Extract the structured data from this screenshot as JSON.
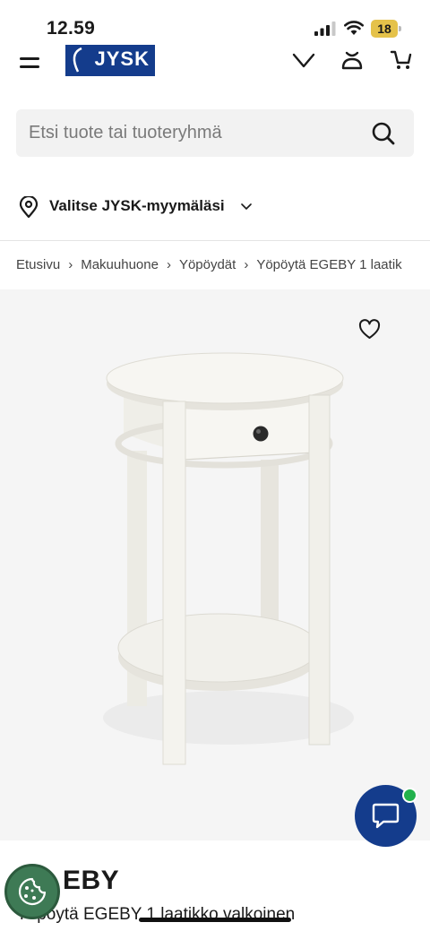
{
  "status_bar": {
    "time": "12.59",
    "battery": "18",
    "icons": [
      "cellular-signal-icon",
      "wifi-icon",
      "battery-icon"
    ]
  },
  "header": {
    "logo_text": "JYSK",
    "icons": [
      "menu-icon",
      "heart-icon",
      "account-icon",
      "cart-icon"
    ]
  },
  "search": {
    "placeholder": "Etsi tuote tai tuoteryhmä",
    "value": ""
  },
  "store_selector": {
    "label": "Valitse JYSK-myymäläsi"
  },
  "breadcrumb": {
    "items": [
      "Etusivu",
      "Makuuhuone",
      "Yöpöydät",
      "Yöpöytä EGEBY 1 laatik"
    ],
    "separator": "›"
  },
  "product": {
    "name_visible": "EBY",
    "description": "Yöpöytä EGEBY 1 laatikko valkoinen"
  },
  "colors": {
    "brand_blue": "#143c8c",
    "image_background": "#f5f5f5",
    "online_indicator": "#22b14c",
    "cookie_button": "#3e7a55",
    "battery": "#e5c24a"
  }
}
